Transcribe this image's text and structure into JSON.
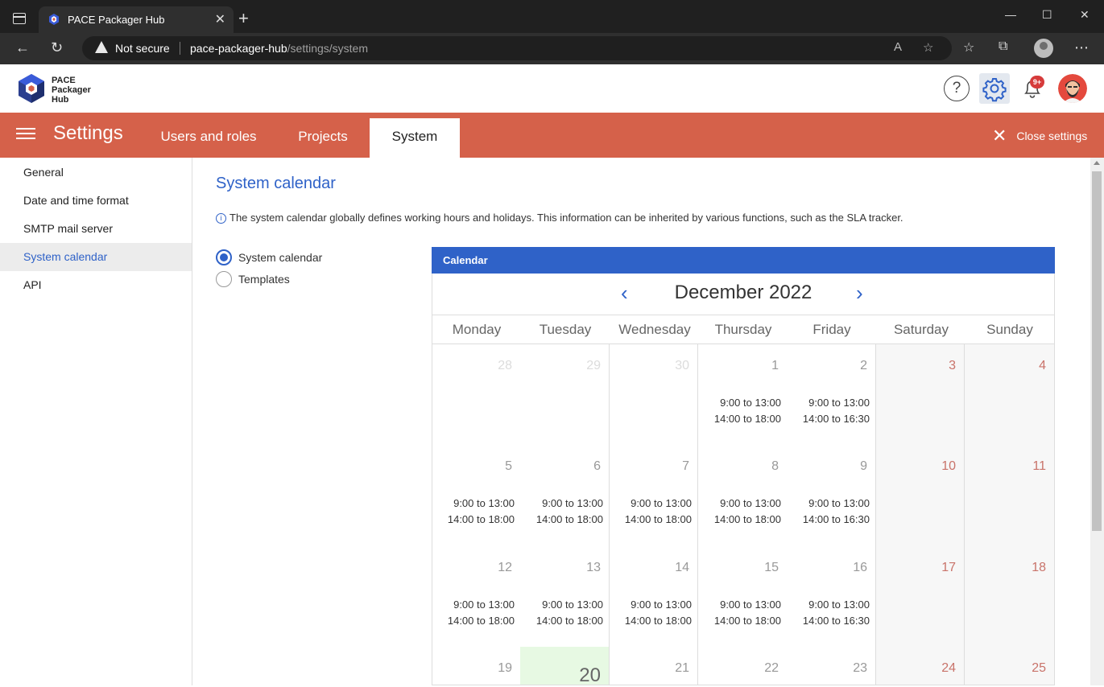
{
  "browser": {
    "tab_title": "PACE Packager Hub",
    "tab_close": "✕",
    "new_tab": "+",
    "security_label": "Not secure",
    "url_host": "pace-packager-hub",
    "url_path": "/settings/system",
    "window_controls": [
      "—",
      "☐",
      "✕"
    ]
  },
  "app": {
    "logo_lines": [
      "PACE",
      "Packager",
      "Hub"
    ],
    "help_glyph": "?",
    "notification_badge": "9+",
    "accent_color": "#d5614a",
    "brand_blue": "#2f62c8"
  },
  "settings_bar": {
    "title": "Settings",
    "tabs": [
      {
        "label": "Users and roles",
        "active": false
      },
      {
        "label": "Projects",
        "active": false
      },
      {
        "label": "System",
        "active": true
      }
    ],
    "close_icon": "✕",
    "close_label": "Close settings"
  },
  "sidebar": {
    "items": [
      {
        "label": "General",
        "active": false
      },
      {
        "label": "Date and time format",
        "active": false
      },
      {
        "label": "SMTP mail server",
        "active": false
      },
      {
        "label": "System calendar",
        "active": true
      },
      {
        "label": "API",
        "active": false
      }
    ]
  },
  "main": {
    "title": "System calendar",
    "info_glyph": "i",
    "info_text": "The system calendar globally defines working hours and holidays. This information can be inherited by various functions, such as the SLA tracker.",
    "radios": [
      {
        "label": "System calendar",
        "checked": true
      },
      {
        "label": "Templates",
        "checked": false
      }
    ]
  },
  "calendar": {
    "header": "Calendar",
    "prev_glyph": "‹",
    "next_glyph": "›",
    "month": "December 2022",
    "weekdays": [
      "Monday",
      "Tuesday",
      "Wednesday",
      "Thursday",
      "Friday",
      "Saturday",
      "Sunday"
    ],
    "weeks": [
      [
        {
          "day": "28",
          "other": true,
          "hours": []
        },
        {
          "day": "29",
          "other": true,
          "hours": []
        },
        {
          "day": "30",
          "other": true,
          "hours": []
        },
        {
          "day": "1",
          "hours": [
            "9:00 to 13:00",
            "14:00 to 18:00"
          ]
        },
        {
          "day": "2",
          "hours": [
            "9:00 to 13:00",
            "14:00 to 16:30"
          ]
        },
        {
          "day": "3",
          "weekend": true,
          "hours": []
        },
        {
          "day": "4",
          "weekend": true,
          "hours": []
        }
      ],
      [
        {
          "day": "5",
          "hours": [
            "9:00 to 13:00",
            "14:00 to 18:00"
          ]
        },
        {
          "day": "6",
          "hours": [
            "9:00 to 13:00",
            "14:00 to 18:00"
          ]
        },
        {
          "day": "7",
          "hours": [
            "9:00 to 13:00",
            "14:00 to 18:00"
          ]
        },
        {
          "day": "8",
          "hours": [
            "9:00 to 13:00",
            "14:00 to 18:00"
          ]
        },
        {
          "day": "9",
          "hours": [
            "9:00 to 13:00",
            "14:00 to 16:30"
          ]
        },
        {
          "day": "10",
          "weekend": true,
          "hours": []
        },
        {
          "day": "11",
          "weekend": true,
          "hours": []
        }
      ],
      [
        {
          "day": "12",
          "hours": [
            "9:00 to 13:00",
            "14:00 to 18:00"
          ]
        },
        {
          "day": "13",
          "hours": [
            "9:00 to 13:00",
            "14:00 to 18:00"
          ]
        },
        {
          "day": "14",
          "hours": [
            "9:00 to 13:00",
            "14:00 to 18:00"
          ]
        },
        {
          "day": "15",
          "hours": [
            "9:00 to 13:00",
            "14:00 to 18:00"
          ]
        },
        {
          "day": "16",
          "hours": [
            "9:00 to 13:00",
            "14:00 to 16:30"
          ]
        },
        {
          "day": "17",
          "weekend": true,
          "hours": []
        },
        {
          "day": "18",
          "weekend": true,
          "hours": []
        }
      ],
      [
        {
          "day": "19",
          "hours": []
        },
        {
          "day": "20",
          "today": true,
          "hours": []
        },
        {
          "day": "21",
          "hours": []
        },
        {
          "day": "22",
          "hours": []
        },
        {
          "day": "23",
          "hours": []
        },
        {
          "day": "24",
          "weekend": true,
          "hours": []
        },
        {
          "day": "25",
          "weekend": true,
          "hours": []
        }
      ]
    ]
  }
}
